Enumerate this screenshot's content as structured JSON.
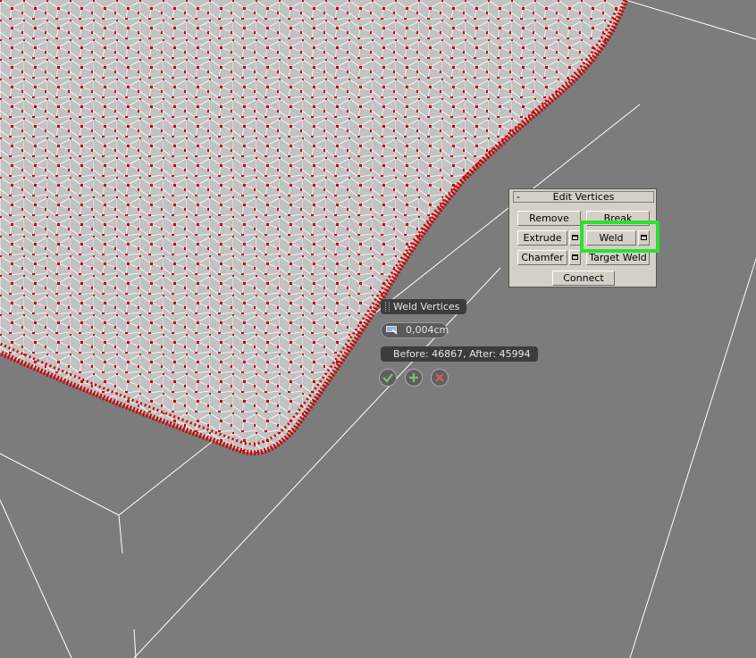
{
  "rollout": {
    "title": "Edit Vertices",
    "collapse_symbol": "-",
    "buttons": {
      "remove": "Remove",
      "break": "Break",
      "extrude": "Extrude",
      "weld": "Weld",
      "chamfer": "Chamfer",
      "target_weld": "Target Weld",
      "connect": "Connect"
    }
  },
  "caddy": {
    "title": "Weld Vertices",
    "threshold_value": "0,004cm",
    "info": "Before: 46867, After: 45994",
    "actions": [
      "ok-icon",
      "apply-and-continue-icon",
      "cancel-icon"
    ]
  },
  "colors": {
    "viewport_bg": "#7c7c7c",
    "mesh_fill": "#c2c2c2",
    "vertex": "#cc0000",
    "highlight": "#2ee02e"
  }
}
